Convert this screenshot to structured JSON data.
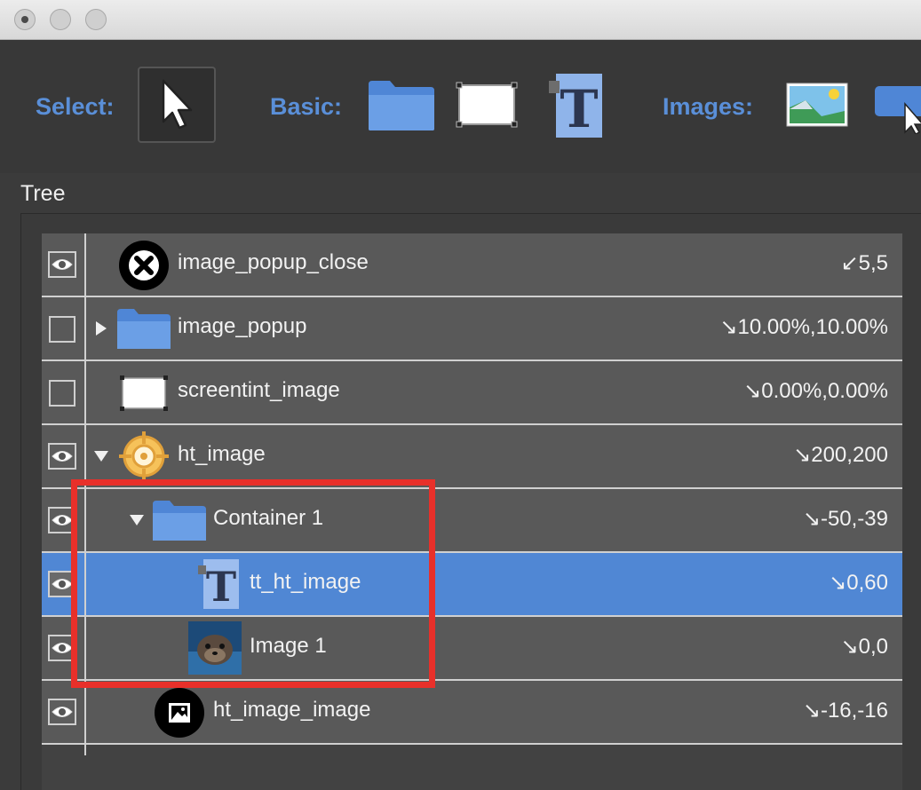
{
  "window": {
    "buttons": [
      "close-button",
      "minimize-button",
      "zoom-button"
    ]
  },
  "toolbar": {
    "select_label": "Select:",
    "basic_label": "Basic:",
    "images_label": "Images:",
    "tools": {
      "select": "arrow-pointer-icon",
      "container": "folder-icon",
      "rectangle": "rectangle-icon",
      "text": "text-icon",
      "image": "image-icon",
      "button": "image-button-icon"
    }
  },
  "tree": {
    "title": "Tree",
    "rows": [
      {
        "name": "image_popup_close",
        "coord": "↙5,5",
        "visibility": "eye",
        "icon": "close-circle-icon",
        "expander": ""
      },
      {
        "name": "image_popup",
        "coord": "↘10.00%,10.00%",
        "visibility": "checkbox",
        "icon": "folder-icon",
        "expander": "collapsed"
      },
      {
        "name": "screentint_image",
        "coord": "↘0.00%,0.00%",
        "visibility": "checkbox",
        "icon": "rectangle-icon",
        "expander": ""
      },
      {
        "name": "ht_image",
        "coord": "↘200,200",
        "visibility": "eye",
        "icon": "hotspot-target-icon",
        "expander": "expanded"
      },
      {
        "name": "Container 1",
        "coord": "↘-50,-39",
        "visibility": "eye",
        "icon": "folder-icon",
        "expander": "expanded"
      },
      {
        "name": "tt_ht_image",
        "coord": "↘0,60",
        "visibility": "eye",
        "icon": "text-icon",
        "expander": "",
        "selected": true
      },
      {
        "name": "Image 1",
        "coord": "↘0,0",
        "visibility": "eye",
        "icon": "image-thumbnail-icon",
        "expander": ""
      },
      {
        "name": "ht_image_image",
        "coord": "↘-16,-16",
        "visibility": "eye",
        "icon": "image-circle-icon",
        "expander": ""
      }
    ]
  },
  "colors": {
    "accent": "#5a8fd8",
    "selected_row": "#5087d4",
    "highlight": "#e8302a",
    "folder": "#5b8fd9"
  }
}
